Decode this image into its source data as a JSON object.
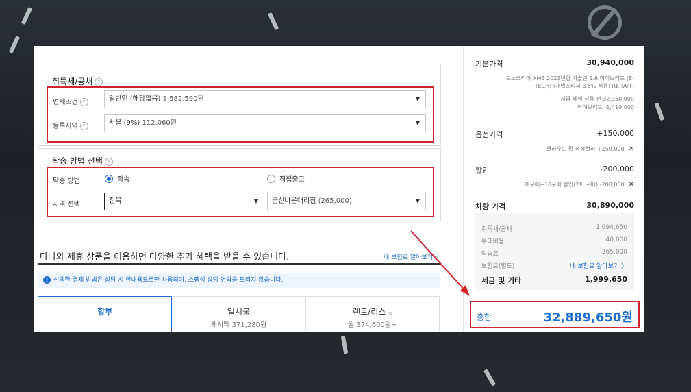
{
  "tax_section": {
    "title": "취득세/공채",
    "help": "?",
    "exemption": {
      "label": "면세조건",
      "value": "일반인 (해당없음)",
      "amount": "1,582,590원"
    },
    "region": {
      "label": "등록지역",
      "value": "서울 (9%)",
      "amount": "112,060원"
    }
  },
  "delivery_section": {
    "title": "탁송 방법 선택",
    "help": "?",
    "method_label": "탁송 방법",
    "option_delivery": "탁송",
    "option_direct": "직접출고",
    "region_label": "지역 선택",
    "region_value": "전북",
    "branch_value": "군산나운대리점",
    "branch_amount": "(265,000)"
  },
  "promo": {
    "text": "다나와 제휴 상품을 이용하면 다양한 추가 혜택을 받을 수 있습니다.",
    "link": "내 보험료 알아보기 〉",
    "notice": "선택한 결제 방법은 상담 시 안내용도로만 사용되며, 스팸성 상담 연락을 드리지 않습니다."
  },
  "payment_tabs": [
    {
      "label": "할부",
      "sub": ""
    },
    {
      "label": "일시불",
      "sub": "캐시백 371,280원"
    },
    {
      "label": "렌트/리스",
      "sub": "월 374,600원~"
    }
  ],
  "price": {
    "base_label": "기본가격",
    "base_value": "30,940,000",
    "base_desc1": "르노코리아 XM3 2023년형 가솔린 1.6 하이브리드 (E-",
    "base_desc2": "TECH) (개별소비세 3.5% 적용) RE (A/T)",
    "pre_tax_label": "세금 혜택 적용 전",
    "pre_tax_value": "32,350,000",
    "hybrid_label": "하이브리드",
    "hybrid_value": "-1,410,000",
    "option_label": "옵션가격",
    "option_value": "+150,000",
    "option_item": "클라우드 펄 외장컬러",
    "option_item_value": "+150,000",
    "discount_label": "할인",
    "discount_value": "-200,000",
    "discount_item": "재구매~10구매 할인(2회 구매)",
    "discount_item_value": "-200,000",
    "vehicle_label": "차량 가격",
    "vehicle_value": "30,890,000"
  },
  "summary": {
    "tax_label": "취득세/공채",
    "tax_value": "1,694,650",
    "extra_label": "부대비용",
    "extra_value": "40,000",
    "delivery_label": "탁송료",
    "delivery_value": "265,000",
    "insurance_label": "보험료(별도)",
    "insurance_link": "내 보험료 알아보기 〉",
    "total_label": "세금 및 기타",
    "total_value": "1,999,650"
  },
  "grand_total": {
    "label": "총합",
    "value": "32,889,650원"
  },
  "icons": {
    "remove": "close-icon",
    "dropdown": "chevron-down-icon",
    "info": "info-icon"
  },
  "colors": {
    "accent": "#1f6fd1",
    "highlight": "#d0232a"
  }
}
